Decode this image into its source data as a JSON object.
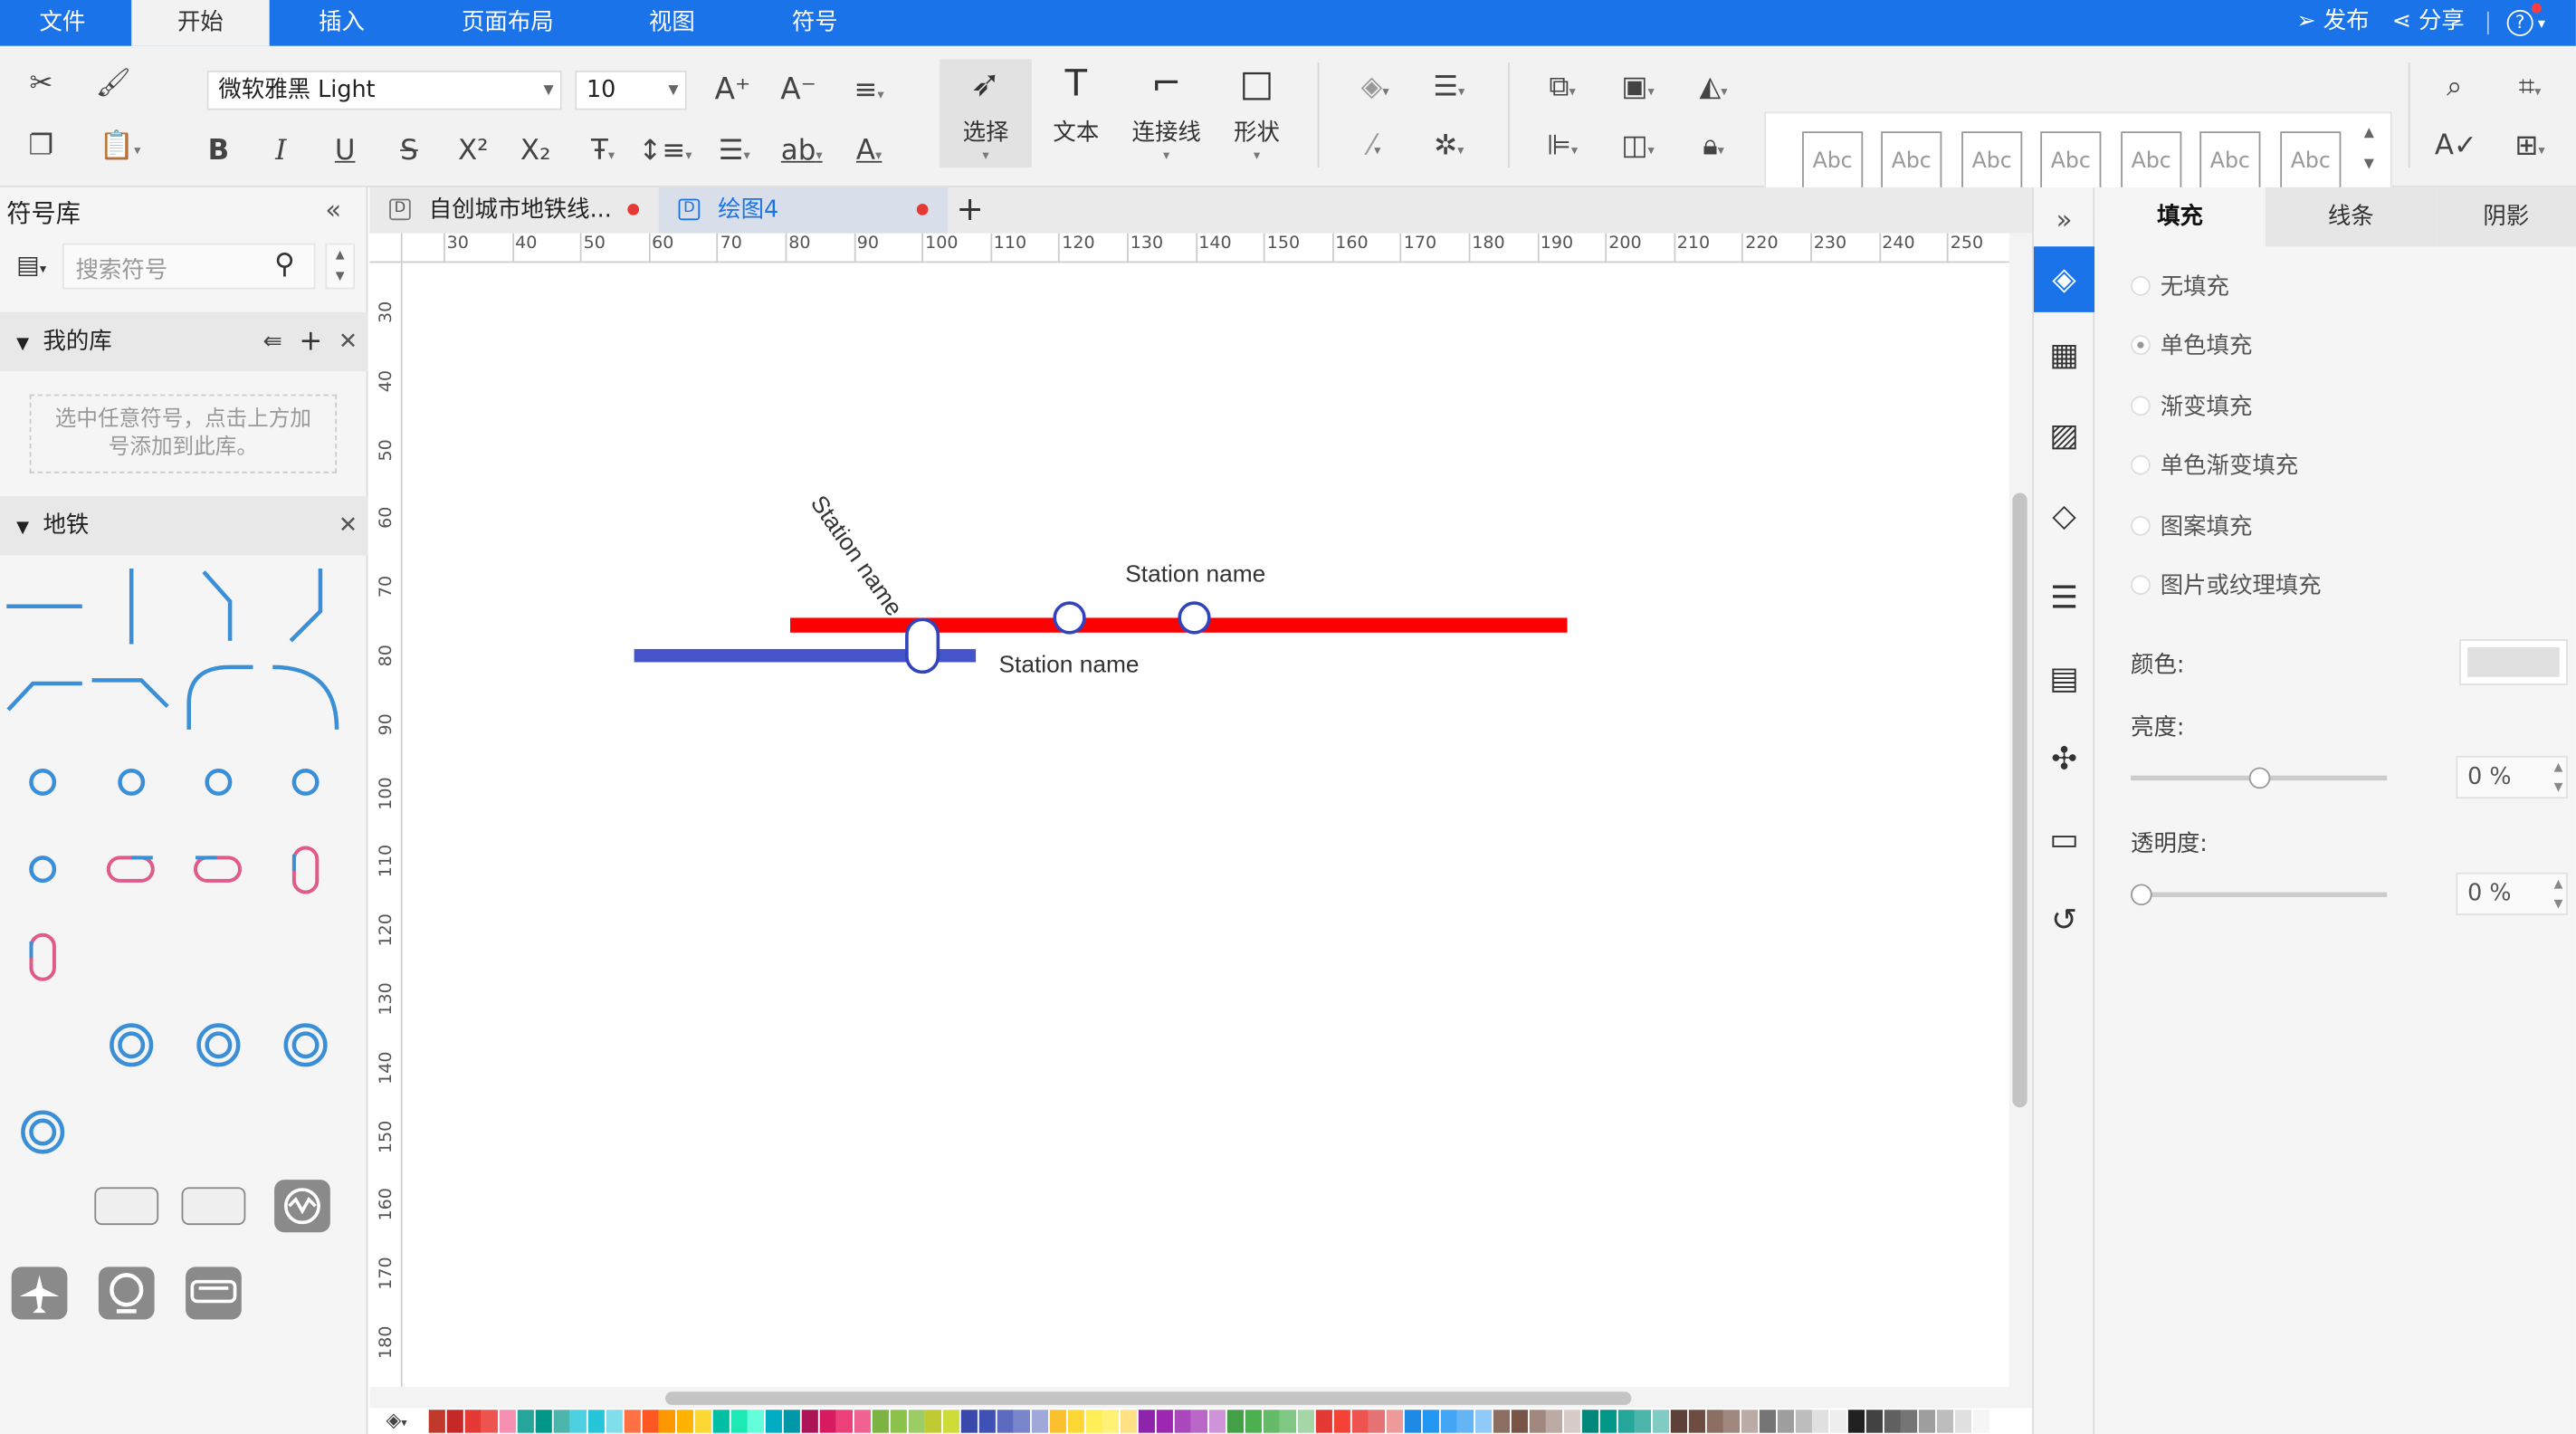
{
  "menubar": {
    "tabs": [
      "文件",
      "开始",
      "插入",
      "页面布局",
      "视图",
      "符号"
    ],
    "active_tab": "开始",
    "publish_label": "发布",
    "share_label": "分享",
    "help_label": "?"
  },
  "ribbon": {
    "font_name": "微软雅黑 Light",
    "font_size": "10",
    "select_label": "选择",
    "text_label": "文本",
    "connector_label": "连接线",
    "shape_label": "形状",
    "style_samples": [
      "Abc",
      "Abc",
      "Abc",
      "Abc",
      "Abc",
      "Abc",
      "Abc"
    ]
  },
  "symbol_library": {
    "title": "符号库",
    "search_placeholder": "搜索符号",
    "my_library": {
      "title": "我的库",
      "hint": "选中任意符号，点击上方加号添加到此库。"
    },
    "metro_section": {
      "title": "地铁"
    }
  },
  "tabs": [
    {
      "label": "自创城市地铁线...",
      "unsaved": true
    },
    {
      "label": "绘图4",
      "unsaved": true,
      "active": true
    }
  ],
  "ruler": {
    "h_ticks": [
      "30",
      "40",
      "50",
      "60",
      "70",
      "80",
      "90",
      "100",
      "110",
      "120",
      "130",
      "140",
      "150",
      "160",
      "170",
      "180",
      "190",
      "200",
      "210",
      "220",
      "230",
      "240",
      "250"
    ],
    "v_ticks": [
      "30",
      "40",
      "50",
      "60",
      "70",
      "80",
      "90",
      "100",
      "110",
      "120",
      "130",
      "140",
      "150",
      "160",
      "170",
      "180"
    ]
  },
  "canvas": {
    "station_label_diagonal": "Station name",
    "station_label_top": "Station name",
    "station_label_bottom": "Station name",
    "red_line_color": "#ff0000",
    "blue_line_color": "#4455cc"
  },
  "properties": {
    "tabs": [
      "填充",
      "线条",
      "阴影"
    ],
    "active_tab": "填充",
    "fill_options": [
      "无填充",
      "单色填充",
      "渐变填充",
      "单色渐变填充",
      "图案填充",
      "图片或纹理填充"
    ],
    "selected_fill": "单色填充",
    "color_label": "颜色:",
    "color_value": "#e0e0e0",
    "brightness_label": "亮度:",
    "brightness_value": "0 %",
    "transparency_label": "透明度:",
    "transparency_value": "0 %"
  },
  "palette_colors": [
    "#c0392b",
    "#c62828",
    "#e53935",
    "#ef5350",
    "#f48fb1",
    "#26a69a",
    "#009688",
    "#4db6ac",
    "#4dd0e1",
    "#26c6da",
    "#80deea",
    "#ff7043",
    "#ff5722",
    "#ff9800",
    "#ffb300",
    "#fdd835",
    "#00bfa5",
    "#1de9b6",
    "#64ffda",
    "#00acc1",
    "#0097a7",
    "#ad1457",
    "#d81b60",
    "#ec407a",
    "#f06292",
    "#7cb342",
    "#8bc34a",
    "#9ccc65",
    "#c0ca33",
    "#cddc39",
    "#3949ab",
    "#3f51b5",
    "#5c6bc0",
    "#7986cb",
    "#9fa8da",
    "#fbc02d",
    "#fdd835",
    "#ffee58",
    "#fff176",
    "#ffe082",
    "#8e24aa",
    "#9c27b0",
    "#ab47bc",
    "#ba68c8",
    "#ce93d8",
    "#43a047",
    "#4caf50",
    "#66bb6a",
    "#81c784",
    "#a5d6a7",
    "#e53935",
    "#f44336",
    "#ef5350",
    "#e57373",
    "#ef9a9a",
    "#1e88e5",
    "#2196f3",
    "#42a5f5",
    "#64b5f6",
    "#90caf9",
    "#8d6e63",
    "#795548",
    "#a1887f",
    "#bcaaa4",
    "#d7ccc8",
    "#00897b",
    "#009688",
    "#26a69a",
    "#4db6ac",
    "#80cbc4",
    "#5d4037",
    "#6d4c41",
    "#8d6e63",
    "#a1887f",
    "#bcaaa4",
    "#757575",
    "#9e9e9e",
    "#bdbdbd",
    "#e0e0e0",
    "#eeeeee",
    "#212121",
    "#424242",
    "#616161",
    "#757575",
    "#9e9e9e",
    "#bdbdbd",
    "#e0e0e0",
    "#f5f5f5"
  ]
}
